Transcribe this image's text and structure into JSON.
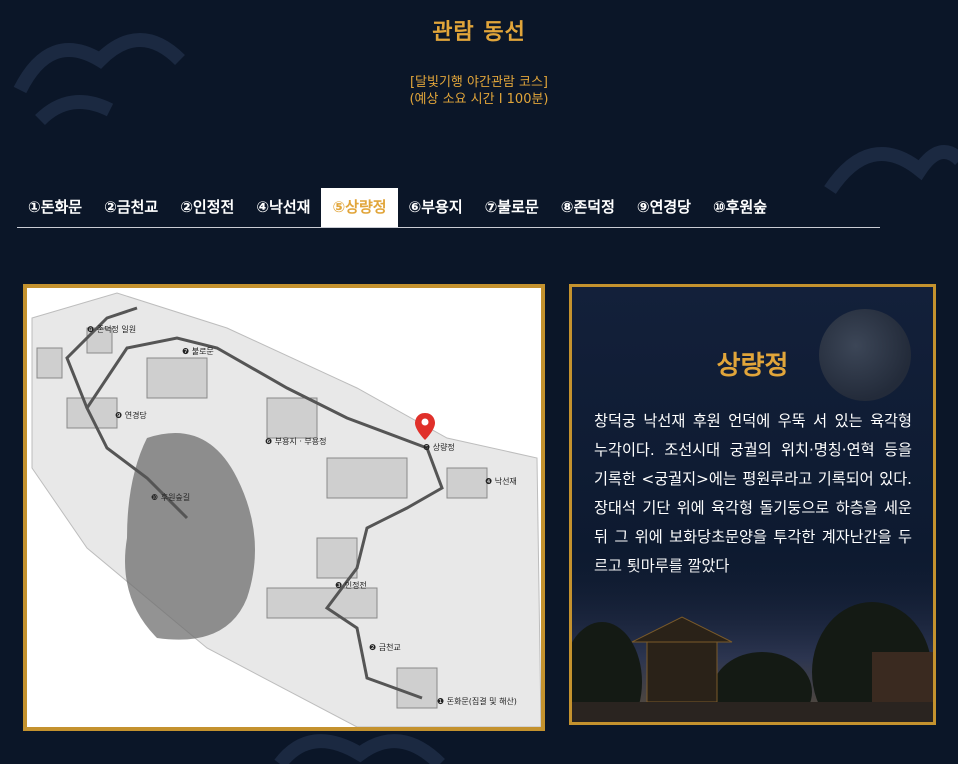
{
  "page": {
    "title": "관람 동선",
    "subtitle_line1": "[달빛기행 야간관람 코스]",
    "subtitle_line2": "(예상 소요 시간 I 100분)"
  },
  "tabs": [
    {
      "label": "①돈화문",
      "active": false
    },
    {
      "label": "②금천교",
      "active": false
    },
    {
      "label": "②인정전",
      "active": false
    },
    {
      "label": "④낙선재",
      "active": false
    },
    {
      "label": "⑤상량정",
      "active": true
    },
    {
      "label": "⑥부용지",
      "active": false
    },
    {
      "label": "⑦불로문",
      "active": false
    },
    {
      "label": "⑧존덕정",
      "active": false
    },
    {
      "label": "⑨연경당",
      "active": false
    },
    {
      "label": "⑩후원숲",
      "active": false
    }
  ],
  "map": {
    "labels": {
      "l1": "❶ 돈화문(집결 및 해산)",
      "l2": "❷ 금천교",
      "l3": "❸ 인정전",
      "l4": "❹ 낙선재",
      "l5": "❺ 상량정",
      "l6": "❻ 부용지 · 부용정",
      "l7": "❼ 불로문",
      "l8": "❽ 존덕정 일원",
      "l9": "❾ 연경당",
      "l10": "❿ 후원숲길"
    },
    "marker_color": "#e0302a"
  },
  "info": {
    "title": "상량정",
    "description": "창덕궁 낙선재 후원 언덕에 우뚝 서 있는 육각형 누각이다. 조선시대 궁궐의 위치·명칭·연혁 등을 기록한 <궁궐지>에는 평원루라고 기록되어 있다. 장대석 기단 위에 육각형 돌기둥으로 하층을 세운 뒤 그 위에 보화당초문양을 투각한 계자난간을 두르고 툇마루를 깔았다"
  },
  "colors": {
    "background": "#0b1628",
    "accent": "#e1a53a",
    "frame": "#c4922e"
  }
}
